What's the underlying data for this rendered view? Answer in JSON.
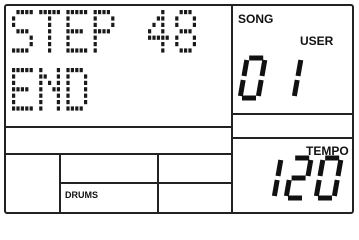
{
  "display": {
    "line1": "STEP 48",
    "line2": "END",
    "song_label": "SONG",
    "user_label": "USER",
    "song_number": "01",
    "tempo_label": "TEMPO",
    "tempo_value": "120",
    "part_label": "DRUMS"
  }
}
